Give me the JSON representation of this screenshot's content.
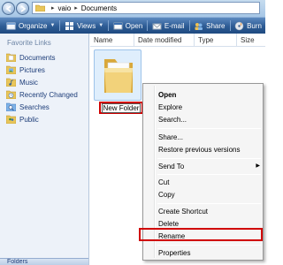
{
  "address": {
    "crumbs": [
      "vaio",
      "Documents"
    ]
  },
  "toolbar": {
    "organize": "Organize",
    "views": "Views",
    "open": "Open",
    "email": "E-mail",
    "share": "Share",
    "burn": "Burn"
  },
  "sidebar": {
    "heading": "Favorite Links",
    "items": [
      {
        "label": "Documents",
        "icon": "documents-icon"
      },
      {
        "label": "Pictures",
        "icon": "pictures-icon"
      },
      {
        "label": "Music",
        "icon": "music-icon"
      },
      {
        "label": "Recently Changed",
        "icon": "recently-changed-icon"
      },
      {
        "label": "Searches",
        "icon": "searches-icon"
      },
      {
        "label": "Public",
        "icon": "public-icon"
      }
    ],
    "folders_label": "Folders"
  },
  "columns": [
    "Name",
    "Date modified",
    "Type",
    "Size"
  ],
  "folder": {
    "name": "New Folder"
  },
  "context_menu": {
    "items": [
      "Open",
      "Explore",
      "Search...",
      "Share...",
      "Restore previous versions",
      "Send To",
      "Cut",
      "Copy",
      "Create Shortcut",
      "Delete",
      "Rename",
      "Properties"
    ]
  },
  "colors": {
    "highlight_box": "#d00000",
    "toolbar": "#2d5b94",
    "link_text": "#1c3c78"
  }
}
